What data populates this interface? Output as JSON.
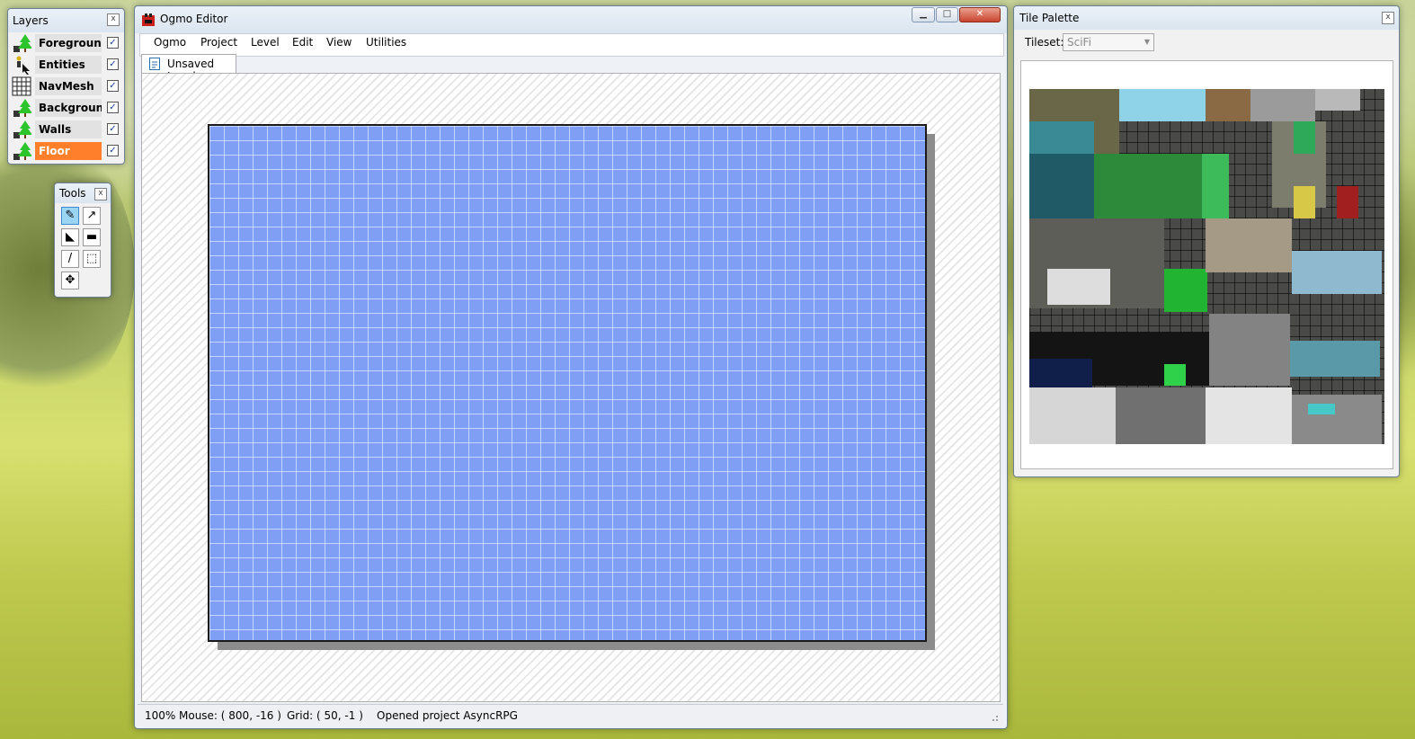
{
  "colors": {
    "accent_active_layer": "#ff7f2a",
    "level_fill": "#7f9ff5",
    "close_red": "#c9452f"
  },
  "layers_panel": {
    "title": "Layers",
    "close_label": "x",
    "items": [
      {
        "label": "Foreground_",
        "icon": "tree-icon",
        "checked": "✓"
      },
      {
        "label": "Entities",
        "icon": "entity-icon",
        "checked": "✓"
      },
      {
        "label": "NavMesh",
        "icon": "grid-icon",
        "checked": "✓"
      },
      {
        "label": "Backgroun_",
        "icon": "tree-icon",
        "checked": "✓"
      },
      {
        "label": "Walls",
        "icon": "tree-icon",
        "checked": "✓"
      },
      {
        "label": "Floor",
        "icon": "tree-icon",
        "checked": "✓",
        "active": true
      }
    ]
  },
  "tools_panel": {
    "title": "Tools",
    "close_label": "x",
    "tools": [
      {
        "name": "pencil-icon",
        "glyph": "✎",
        "selected": true
      },
      {
        "name": "arrow-icon",
        "glyph": "↗"
      },
      {
        "name": "fill-icon",
        "glyph": "◣"
      },
      {
        "name": "rectangle-icon",
        "glyph": "▬"
      },
      {
        "name": "line-icon",
        "glyph": "/"
      },
      {
        "name": "select-icon",
        "glyph": "⬚"
      },
      {
        "name": "move-icon",
        "glyph": "✥"
      }
    ]
  },
  "main_window": {
    "title": "Ogmo Editor",
    "caption": {
      "minimize": "▁",
      "maximize": "□",
      "close": "✕"
    },
    "menu": [
      "Ogmo",
      "Project",
      "Level",
      "Edit",
      "View",
      "Utilities"
    ],
    "tab": "Unsaved Level",
    "status": {
      "zoom": "100%",
      "mouse": "Mouse: ( 800, -16 )",
      "grid": "Grid: ( 50, -1 )",
      "message": "Opened project AsyncRPG"
    }
  },
  "tile_palette": {
    "title": "Tile Palette",
    "close_label": "x",
    "tileset_label": "Tileset:",
    "tileset_value": "SciFi",
    "dropdown_arrow": "▼"
  }
}
